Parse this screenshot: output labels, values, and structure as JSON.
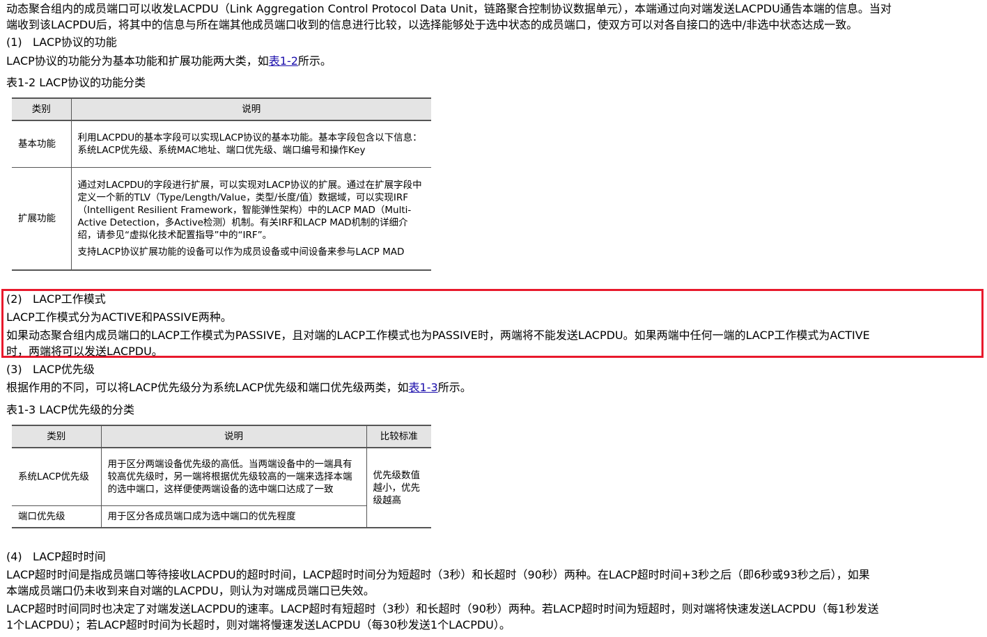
{
  "intro": {
    "line1": "动态聚合组内的成员端口可以收发LACPDU（Link Aggregation Control Protocol Data Unit，链路聚合控制协议数据单元），本端通过向对端发送LACPDU通告本端的信息。当对",
    "line2": "端收到该LACPDU后，将其中的信息与所在端其他成员端口收到的信息进行比较，以选择能够处于选中状态的成员端口，使双方可以对各自接口的选中/非选中状态达成一致。"
  },
  "sec1": {
    "num": "(1)",
    "title": "LACP协议的功能",
    "text_pre": "LACP协议的功能分为基本功能和扩展功能两大类，如",
    "link": "表1-2",
    "text_post": "所示。"
  },
  "table1": {
    "caption": "表1-2 LACP协议的功能分类",
    "headers": [
      "类别",
      "说明"
    ],
    "rows": [
      {
        "category": "基本功能",
        "desc": [
          "利用LACPDU的基本字段可以实现LACP协议的基本功能。基本字段包含以下信息：系统LACP优先级、系统MAC地址、端口优先级、端口编号和操作Key"
        ]
      },
      {
        "category": "扩展功能",
        "desc": [
          "通过对LACPDU的字段进行扩展，可以实现对LACP协议的扩展。通过在扩展字段中定义一个新的TLV（Type/Length/Value，类型/长度/值）数据域，可以实现IRF（Intelligent Resilient Framework，智能弹性架构）中的LACP MAD（Multi-Active Detection，多Active检测）机制。有关IRF和LACP MAD机制的详细介绍，请参见“虚拟化技术配置指导”中的“IRF”。",
          "支持LACP协议扩展功能的设备可以作为成员设备或中间设备来参与LACP MAD"
        ]
      }
    ]
  },
  "sec2": {
    "num": "(2)",
    "title": "LACP工作模式",
    "p1": "LACP工作模式分为ACTIVE和PASSIVE两种。",
    "p2_line1": "如果动态聚合组内成员端口的LACP工作模式为PASSIVE，且对端的LACP工作模式也为PASSIVE时，两端将不能发送LACPDU。如果两端中任何一端的LACP工作模式为ACTIVE",
    "p2_line2": "时，两端将可以发送LACPDU。",
    "highlight_color": "#e8192c"
  },
  "sec3": {
    "num": "(3)",
    "title": "LACP优先级",
    "text_pre": "根据作用的不同，可以将LACP优先级分为系统LACP优先级和端口优先级两类，如",
    "link": "表1-3",
    "text_post": "所示。"
  },
  "table2": {
    "caption": "表1-3 LACP优先级的分类",
    "headers": [
      "类别",
      "说明",
      "比较标准"
    ],
    "rows": [
      {
        "category": "系统LACP优先级",
        "desc": "用于区分两端设备优先级的高低。当两端设备中的一端具有较高优先级时，另一端将根据优先级较高的一端来选择本端的选中端口，这样便使两端设备的选中端口达成了一致"
      },
      {
        "category": "端口优先级",
        "desc": "用于区分各成员端口成为选中端口的优先程度"
      }
    ],
    "criteria": "优先级数值越小，优先级越高"
  },
  "sec4": {
    "num": "(4)",
    "title": "LACP超时时间",
    "p1_line1": "LACP超时时间是指成员端口等待接收LACPDU的超时时间，LACP超时时间分为短超时（3秒）和长超时（90秒）两种。在LACP超时时间+3秒之后（即6秒或93秒之后），如果",
    "p1_line2": "本端成员端口仍未收到来自对端的LACPDU，则认为对端成员端口已失效。",
    "p2_line1": "LACP超时时间同时也决定了对端发送LACPDU的速率。LACP超时有短超时（3秒）和长超时（90秒）两种。若LACP超时时间为短超时，则对端将快速发送LACPDU（每1秒发送",
    "p2_line2": "1个LACPDU）；若LACP超时时间为长超时，则对端将慢速发送LACPDU（每30秒发送1个LACPDU）。"
  }
}
